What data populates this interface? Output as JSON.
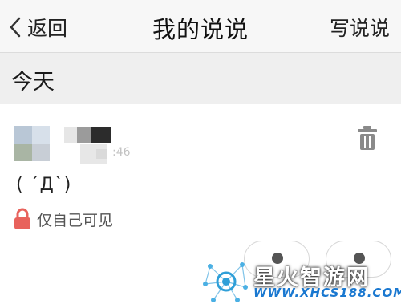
{
  "nav": {
    "back_label": "返回",
    "title": "我的说说",
    "write_label": "写说说"
  },
  "section": {
    "label": "今天"
  },
  "post": {
    "meta_partial": ":46",
    "content": "( ´Д`)",
    "privacy_label": "仅自己可见"
  },
  "watermark": {
    "title": "星火智游网",
    "url": "WWW.XHCS188.COM"
  },
  "colors": {
    "lock": "#e8625c",
    "watermark_url": "#1a78d0",
    "nav_bg": "#f7f7f7",
    "section_bg": "#efefef"
  },
  "icons": [
    "chevron-left-icon",
    "trash-icon",
    "lock-icon",
    "like-icon",
    "comment-icon",
    "watermark-logo-icon"
  ]
}
